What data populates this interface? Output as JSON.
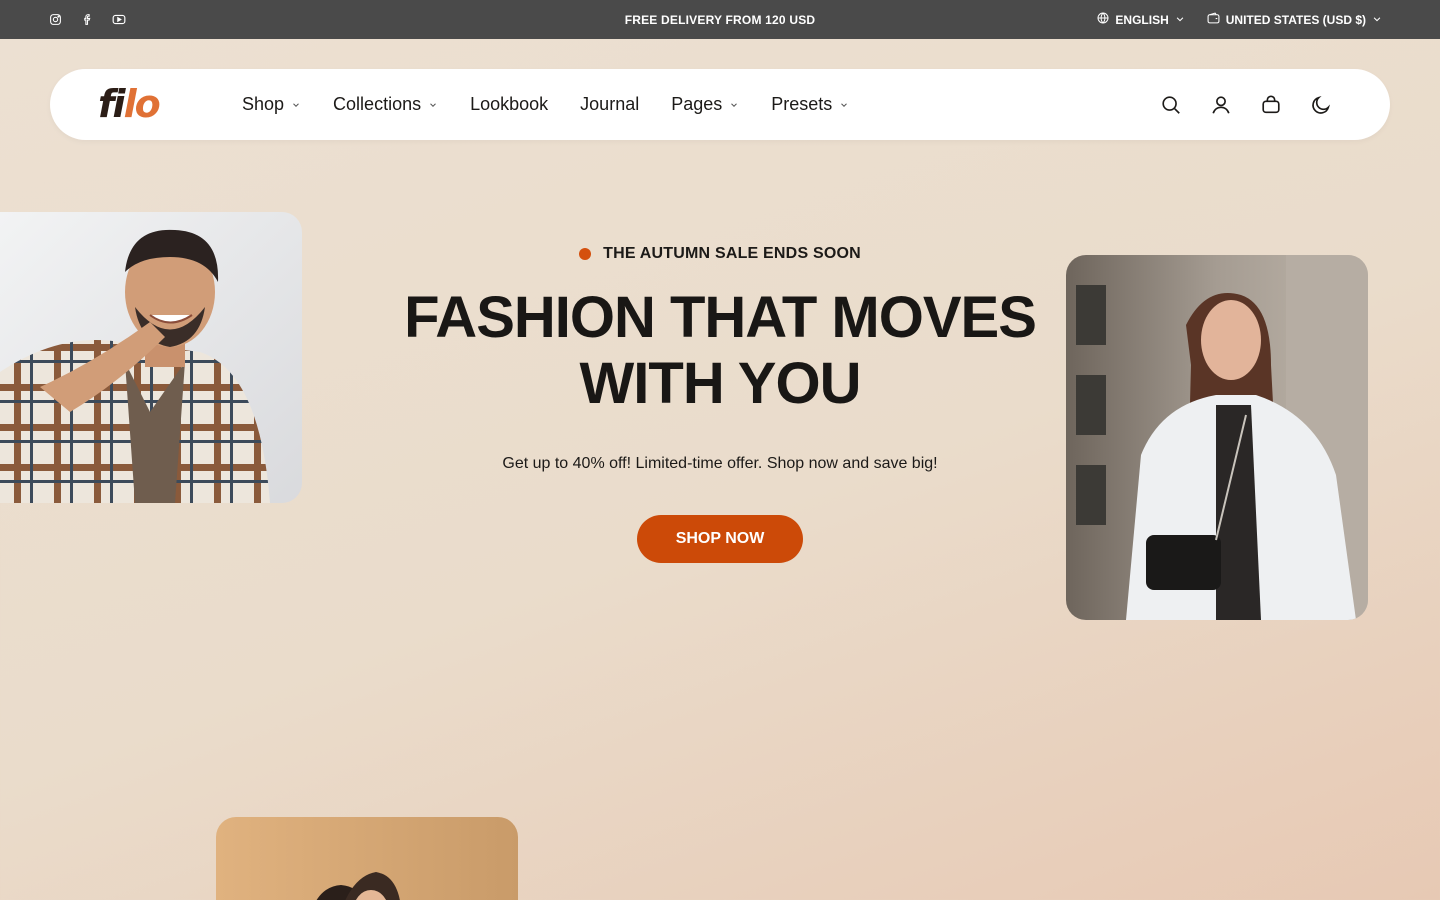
{
  "topbar": {
    "announcement": "FREE DELIVERY FROM 120 USD",
    "language": "ENGLISH",
    "currency": "UNITED STATES (USD $)",
    "socials": [
      "instagram-icon",
      "facebook-icon",
      "youtube-icon"
    ]
  },
  "header": {
    "logo_part1": "fi",
    "logo_part2": "lo",
    "nav": [
      {
        "label": "Shop",
        "dropdown": true
      },
      {
        "label": "Collections",
        "dropdown": true
      },
      {
        "label": "Lookbook",
        "dropdown": false
      },
      {
        "label": "Journal",
        "dropdown": false
      },
      {
        "label": "Pages",
        "dropdown": true
      },
      {
        "label": "Presets",
        "dropdown": true
      }
    ],
    "actions": [
      "search-icon",
      "account-icon",
      "cart-icon",
      "theme-toggle-icon"
    ]
  },
  "hero": {
    "eyebrow": "THE AUTUMN SALE ENDS SOON",
    "headline_line1": "FASHION THAT MOVES",
    "headline_line2": "WITH YOU",
    "subtext": "Get up to 40% off! Limited-time offer. Shop now and save big!",
    "cta": "SHOP NOW"
  },
  "colors": {
    "accent": "#cc4a08",
    "logo_accent": "#e07135",
    "topbar_bg": "#4a4a4a"
  }
}
